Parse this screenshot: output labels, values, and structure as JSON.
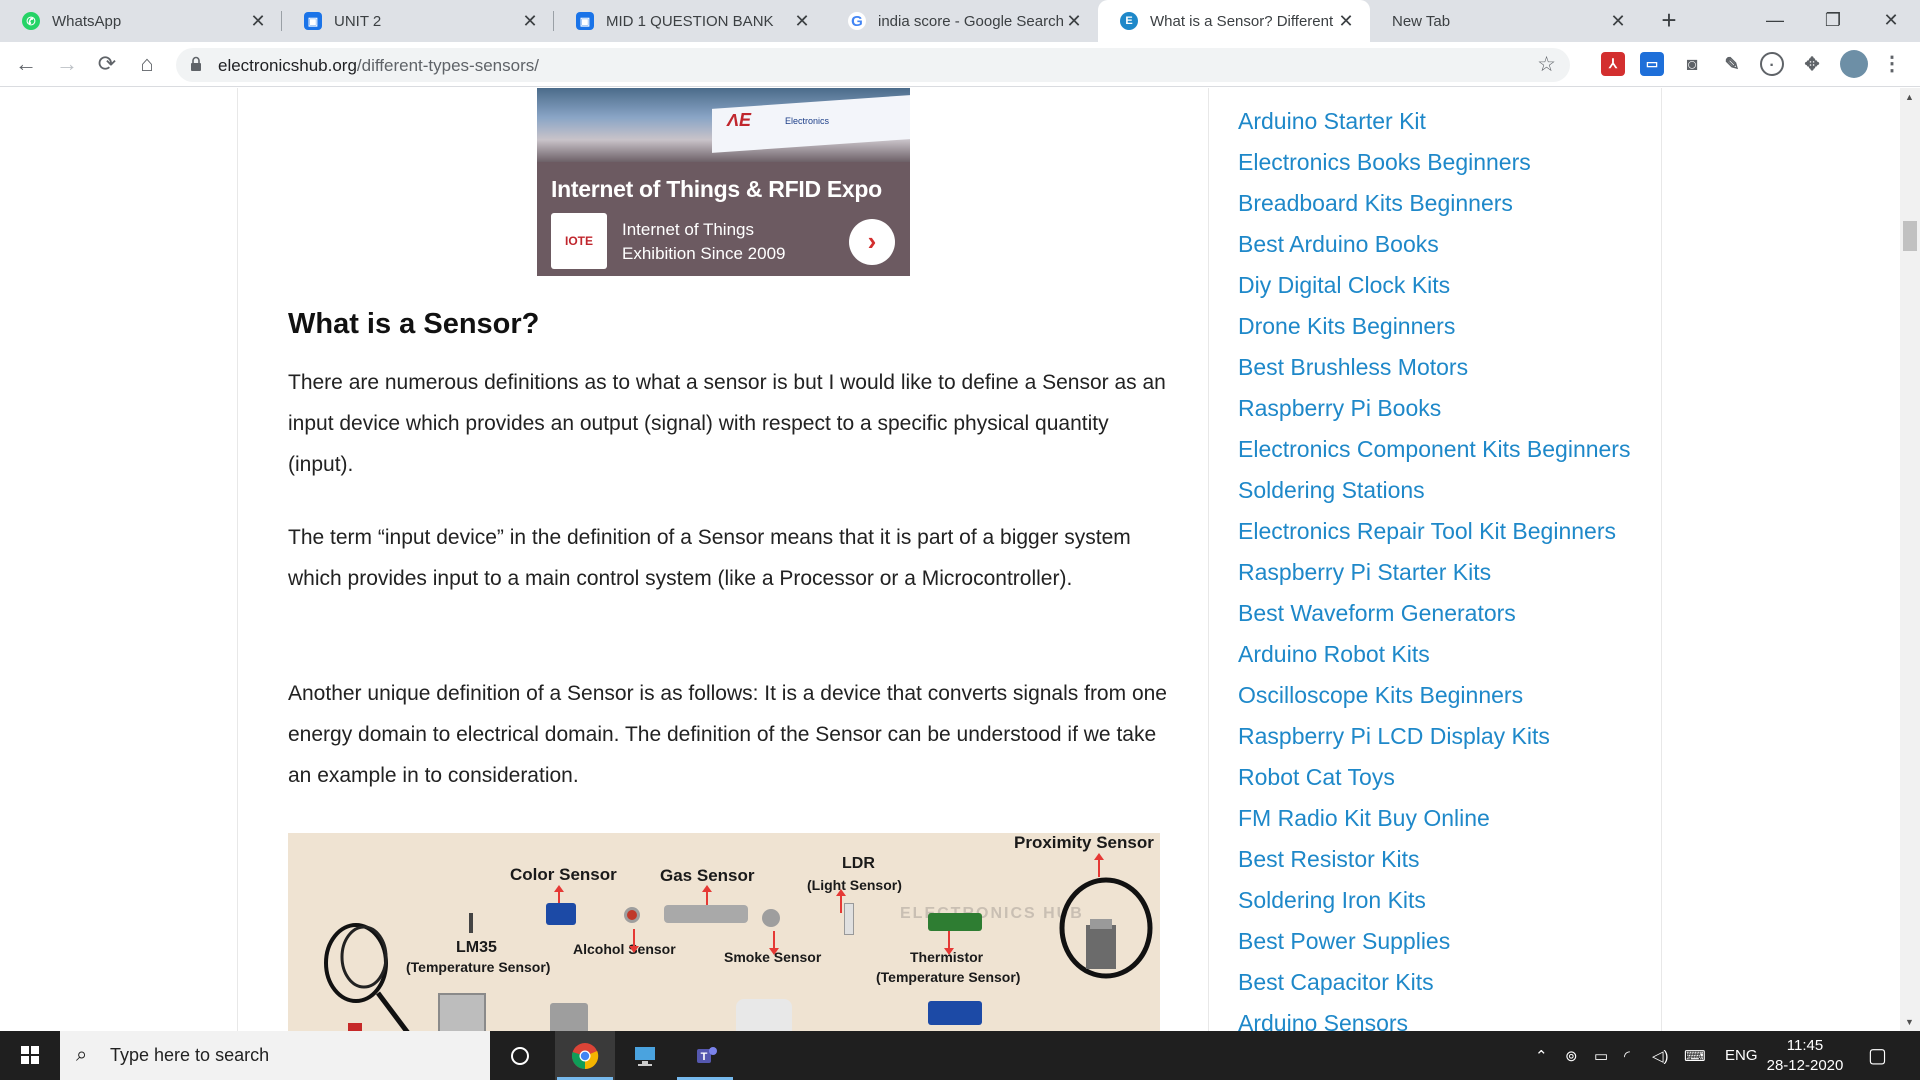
{
  "browser": {
    "tabs": [
      {
        "title": "WhatsApp",
        "icon": "whatsapp-icon"
      },
      {
        "title": "UNIT 2",
        "icon": "google-classroom-icon"
      },
      {
        "title": "MID 1 QUESTION BANK",
        "icon": "google-classroom-icon"
      },
      {
        "title": "india score - Google Search",
        "icon": "google-icon"
      },
      {
        "title": "What is a Sensor? Different T",
        "icon": "electronicshub-icon",
        "active": true
      },
      {
        "title": "New Tab",
        "icon": ""
      }
    ],
    "address": {
      "host": "electronicshub.org",
      "path": "/different-types-sensors/"
    }
  },
  "ad": {
    "headline": "Internet of Things & RFID Expo",
    "line1": "Internet of Things",
    "line2": "Exhibition Since 2009",
    "logo_text": "IOTE",
    "booth_brand": "Electronics"
  },
  "article": {
    "heading": "What is a Sensor?",
    "paragraphs": [
      "There are numerous definitions as to what a sensor is but I would like to define a Sensor as an input device which provides an output (signal) with respect to a specific physical quantity (input).",
      "The term “input device” in the definition of a Sensor means that it is part of a bigger system which provides input to a main control system (like a Processor or a Microcontroller).",
      "Another unique definition of a Sensor is as follows: It is a device that converts signals from one energy domain to electrical domain. The definition of the Sensor can be understood if we take an example in to consideration."
    ],
    "figure_labels": {
      "proximity": "Proximity Sensor",
      "color": "Color Sensor",
      "gas": "Gas Sensor",
      "ldr": "LDR",
      "ldr_sub": "(Light Sensor)",
      "lm35": "LM35",
      "lm35_sub": "(Temperature Sensor)",
      "alcohol": "Alcohol Sensor",
      "smoke": "Smoke Sensor",
      "thermistor": "Thermistor",
      "thermistor_sub": "(Temperature Sensor)",
      "watermark": "ELECTRONICS HUB"
    }
  },
  "sidebar": {
    "links": [
      "Arduino Starter Kit",
      "Electronics Books Beginners",
      "Breadboard Kits Beginners",
      "Best Arduino Books",
      "Diy Digital Clock Kits",
      "Drone Kits Beginners",
      "Best Brushless Motors",
      "Raspberry Pi Books",
      "Electronics Component Kits Beginners",
      "Soldering Stations",
      "Electronics Repair Tool Kit Beginners",
      "Raspberry Pi Starter Kits",
      "Best Waveform Generators",
      "Arduino Robot Kits",
      "Oscilloscope Kits Beginners",
      "Raspberry Pi LCD Display Kits",
      "Robot Cat Toys",
      "FM Radio Kit Buy Online",
      "Best Resistor Kits",
      "Soldering Iron Kits",
      "Best Power Supplies",
      "Best Capacitor Kits",
      "Arduino Sensors"
    ]
  },
  "taskbar": {
    "search_placeholder": "Type here to search",
    "language": "ENG",
    "time": "11:45",
    "date": "28-12-2020"
  },
  "colors": {
    "link": "#1e88c9",
    "tabstrip": "#dee1e6",
    "taskbar": "#1f1f1f"
  }
}
